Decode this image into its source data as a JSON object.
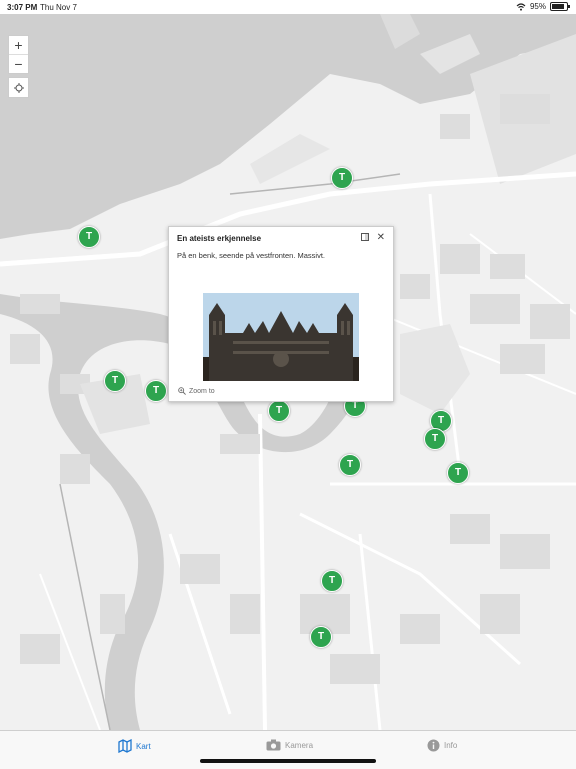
{
  "status_bar": {
    "time": "3:07 PM",
    "date": "Thu Nov 7",
    "battery": "95%",
    "battery_level": 0.95
  },
  "map": {
    "zoom_in_label": "+",
    "zoom_out_label": "−",
    "locate_icon": "locate-icon",
    "marker_label": "T",
    "marker_color": "#2ea44f"
  },
  "popup": {
    "title": "En ateists erkjennelse",
    "body": "På en benk, seende på vestfronten. Massivt.",
    "zoom_to": "Zoom to",
    "close_icon": "close-icon",
    "maximize_icon": "maximize-icon"
  },
  "tabbar": {
    "tabs": [
      {
        "label": "Kart",
        "icon": "map-icon",
        "active": true
      },
      {
        "label": "Kamera",
        "icon": "camera-icon",
        "active": false
      },
      {
        "label": "Info",
        "icon": "info-icon",
        "active": false
      }
    ],
    "active_color": "#1f78d1"
  }
}
